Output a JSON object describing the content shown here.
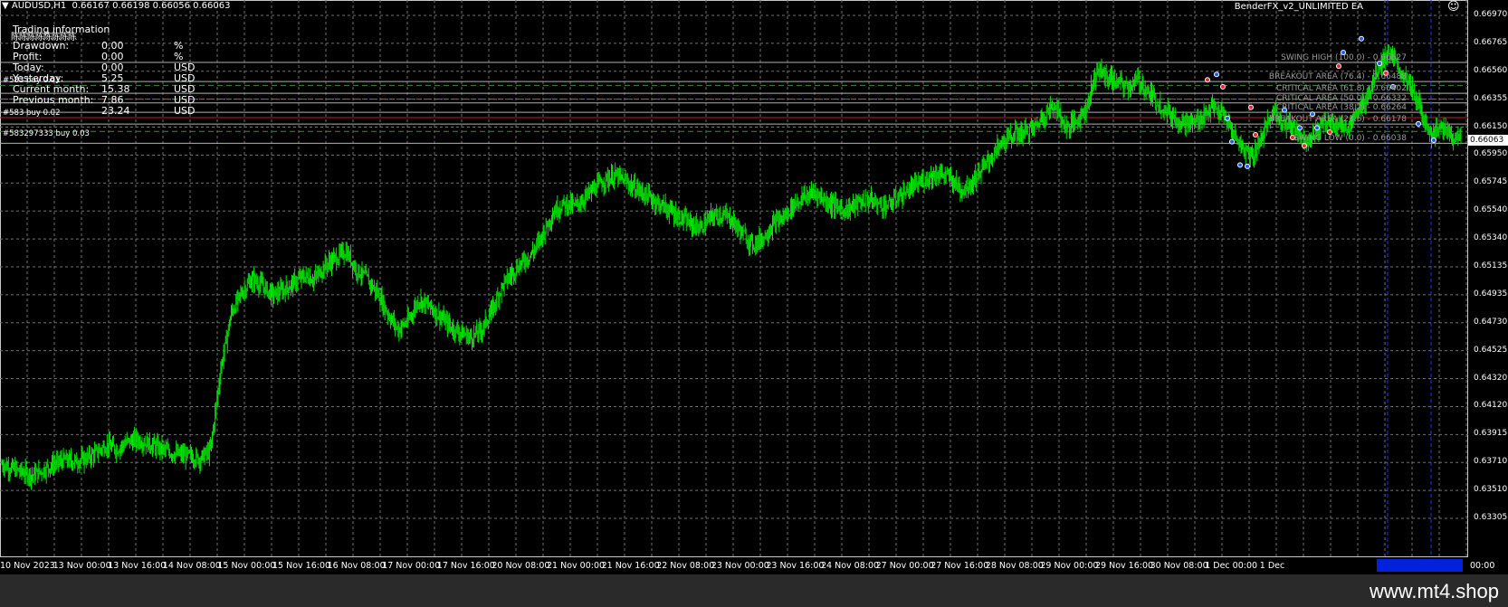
{
  "header": {
    "symbol": "AUDUSD,H1",
    "ohlc": "0.66167 0.66198 0.66056 0.66063",
    "ea_name": "BenderFX_v2_UNLIMITED EA",
    "smiley": "☺"
  },
  "info_panel": {
    "title": "Trading information",
    "garbled": "陈陈陈陈陈陈陈陈",
    "rows": [
      {
        "label": "Drawdown:",
        "value": "0.00",
        "unit": "%"
      },
      {
        "label": "Profit:",
        "value": "0.00",
        "unit": "%"
      },
      {
        "label": "Today:",
        "value": "0.00",
        "unit": "USD"
      },
      {
        "label": "Yesterday:",
        "value": "5.25",
        "unit": "USD"
      },
      {
        "label": "Current month:",
        "value": "15.38",
        "unit": "USD"
      },
      {
        "label": "Previous month:",
        "value": "7.86",
        "unit": "USD"
      },
      {
        "label": "",
        "value": "23.24",
        "unit": "USD"
      }
    ]
  },
  "orders": [
    {
      "text": "#583 buy 0.01"
    },
    {
      "text": "#583 buy 0.02"
    },
    {
      "text": "#583297333 buy 0.03"
    }
  ],
  "levels": [
    {
      "text": "SWING HIGH (100.0) - 0.66627",
      "price": 0.66627,
      "style": "solid",
      "color": "#b0b0b0"
    },
    {
      "text": "BREAKOUT AREA (76.4) - 0.66488",
      "price": 0.66488,
      "style": "solid",
      "color": "#b0b0b0"
    },
    {
      "text": "CRITICAL AREA (61.8) - 0.66402",
      "price": 0.66402,
      "style": "solid",
      "color": "#b0b0b0"
    },
    {
      "text": "CRITICAL AREA (50.0) - 0.66332",
      "price": 0.66332,
      "style": "solid",
      "color": "#b0b0b0"
    },
    {
      "text": "CRITICAL AREA (38.2) - 0.66264",
      "price": 0.66264,
      "style": "solid",
      "color": "#b0b0b0"
    },
    {
      "text": "BREAKOUT AREA (23.6) - 0.66178",
      "price": 0.66178,
      "style": "solid",
      "color": "#b0b0b0"
    },
    {
      "text": "SWING LOW (0.0) - 0.66038",
      "price": 0.66038,
      "style": "solid",
      "color": "#b0b0b0"
    }
  ],
  "order_lines": [
    {
      "price": 0.6646,
      "color": "#3a8a3a",
      "style": "dashed"
    },
    {
      "price": 0.6636,
      "color": "#3a8a3a",
      "style": "dashed"
    },
    {
      "price": 0.66225,
      "color": "#c02020",
      "style": "solid"
    },
    {
      "price": 0.66125,
      "color": "#3a8a3a",
      "style": "dashed"
    }
  ],
  "price_axis": {
    "labels": [
      "0.66970",
      "0.66765",
      "0.66560",
      "0.66355",
      "0.66150",
      "0.65950",
      "0.65745",
      "0.65540",
      "0.65340",
      "0.65135",
      "0.64935",
      "0.64730",
      "0.64525",
      "0.64320",
      "0.64120",
      "0.63915",
      "0.63710",
      "0.63510",
      "0.63305"
    ],
    "current_price": "0.66063",
    "max": 0.6697,
    "min": 0.63305
  },
  "time_axis": {
    "labels": [
      "10 Nov 2023",
      "13 Nov 00:00",
      "13 Nov 16:00",
      "14 Nov 08:00",
      "15 Nov 00:00",
      "15 Nov 16:00",
      "16 Nov 08:00",
      "17 Nov 00:00",
      "17 Nov 16:00",
      "20 Nov 08:00",
      "21 Nov 00:00",
      "21 Nov 16:00",
      "22 Nov 08:00",
      "23 Nov 00:00",
      "23 Nov 16:00",
      "24 Nov 08:00",
      "27 Nov 00:00",
      "27 Nov 16:00",
      "28 Nov 08:00",
      "29 Nov 00:00",
      "29 Nov 16:00",
      "30 Nov 08:00",
      "1 Dec 00:00",
      "1 Dec"
    ],
    "end_label": "00:00"
  },
  "chart_data": {
    "type": "candlestick",
    "symbol": "AUDUSD",
    "timeframe": "H1",
    "series": [
      {
        "name": "AUDUSD,H1",
        "close": [
          0.637,
          0.6367,
          0.6364,
          0.6362,
          0.6366,
          0.637,
          0.6373,
          0.6372,
          0.6374,
          0.6378,
          0.6384,
          0.6381,
          0.6386,
          0.6388,
          0.6385,
          0.6382,
          0.6379,
          0.6377,
          0.6376,
          0.6374,
          0.638,
          0.644,
          0.648,
          0.6495,
          0.6505,
          0.65,
          0.6493,
          0.6497,
          0.6502,
          0.6507,
          0.6505,
          0.6515,
          0.652,
          0.6525,
          0.6512,
          0.6505,
          0.6495,
          0.648,
          0.6468,
          0.6475,
          0.649,
          0.6485,
          0.6478,
          0.647,
          0.6466,
          0.6462,
          0.6468,
          0.6482,
          0.65,
          0.651,
          0.6518,
          0.6525,
          0.654,
          0.6555,
          0.656,
          0.6558,
          0.6565,
          0.6572,
          0.6578,
          0.658,
          0.6575,
          0.657,
          0.6565,
          0.656,
          0.6555,
          0.655,
          0.6545,
          0.6542,
          0.655,
          0.6552,
          0.6548,
          0.6538,
          0.653,
          0.6535,
          0.6545,
          0.655,
          0.656,
          0.6565,
          0.6568,
          0.6562,
          0.6558,
          0.6555,
          0.656,
          0.6563,
          0.656,
          0.6558,
          0.6565,
          0.657,
          0.6575,
          0.658,
          0.6582,
          0.6578,
          0.657,
          0.6575,
          0.6585,
          0.6595,
          0.6605,
          0.661,
          0.6612,
          0.6615,
          0.6625,
          0.6632,
          0.6615,
          0.662,
          0.663,
          0.6658,
          0.6652,
          0.6648,
          0.6645,
          0.665,
          0.664,
          0.6632,
          0.6625,
          0.662,
          0.6618,
          0.6622,
          0.663,
          0.6625,
          0.6612,
          0.66,
          0.6595,
          0.6612,
          0.6628,
          0.6618,
          0.6615,
          0.6606,
          0.6612,
          0.662,
          0.6618,
          0.6615,
          0.6625,
          0.664,
          0.666,
          0.667,
          0.6658,
          0.6645,
          0.663,
          0.661,
          0.6615,
          0.661,
          0.6606
        ]
      }
    ],
    "ylim": [
      0.63305,
      0.6697
    ],
    "ylabel": "",
    "grid": true,
    "candle_color": "#00ff00",
    "background": "#000000"
  }
}
